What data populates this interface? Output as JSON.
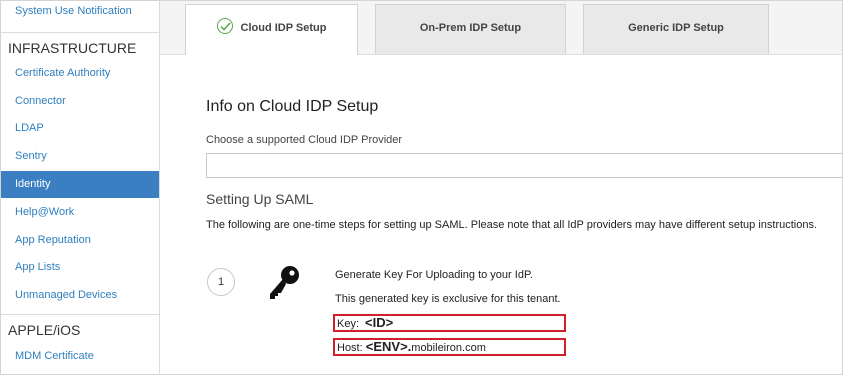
{
  "sidebar": {
    "top_item": "System Use Notification",
    "sections": [
      {
        "title": "INFRASTRUCTURE",
        "items": [
          {
            "label": "Certificate Authority"
          },
          {
            "label": "Connector"
          },
          {
            "label": "LDAP"
          },
          {
            "label": "Sentry"
          },
          {
            "label": "Identity",
            "active": true
          },
          {
            "label": "Help@Work"
          },
          {
            "label": "App Reputation"
          },
          {
            "label": "App Lists"
          },
          {
            "label": "Unmanaged Devices"
          }
        ]
      },
      {
        "title": "APPLE/iOS",
        "items": [
          {
            "label": "MDM Certificate"
          }
        ]
      }
    ]
  },
  "tabs": [
    {
      "label": "Cloud IDP Setup",
      "active": true,
      "icon": "check-circle-icon"
    },
    {
      "label": "On-Prem IDP Setup",
      "active": false
    },
    {
      "label": "Generic IDP Setup",
      "active": false
    }
  ],
  "main": {
    "title": "Info on Cloud IDP Setup",
    "choose_label": "Choose a supported Cloud IDP Provider",
    "provider_value": "",
    "saml_title": "Setting Up SAML",
    "saml_description": "The following are one-time steps for setting up SAML. Please note that all IdP providers may have different setup instructions.",
    "step": {
      "number": "1",
      "icon": "key-icon",
      "line1": "Generate Key For Uploading to your IdP.",
      "line2": "This generated key is exclusive for this tenant.",
      "key_label": "Key:",
      "key_value": "<ID>",
      "host_label": "Host:",
      "host_token": "<ENV>.",
      "host_domain": "mobileiron.com"
    }
  },
  "colors": {
    "accent": "#3a7fc1",
    "link": "#2f7fbe",
    "highlight_border": "#d0202a",
    "check_green": "#58a845"
  }
}
